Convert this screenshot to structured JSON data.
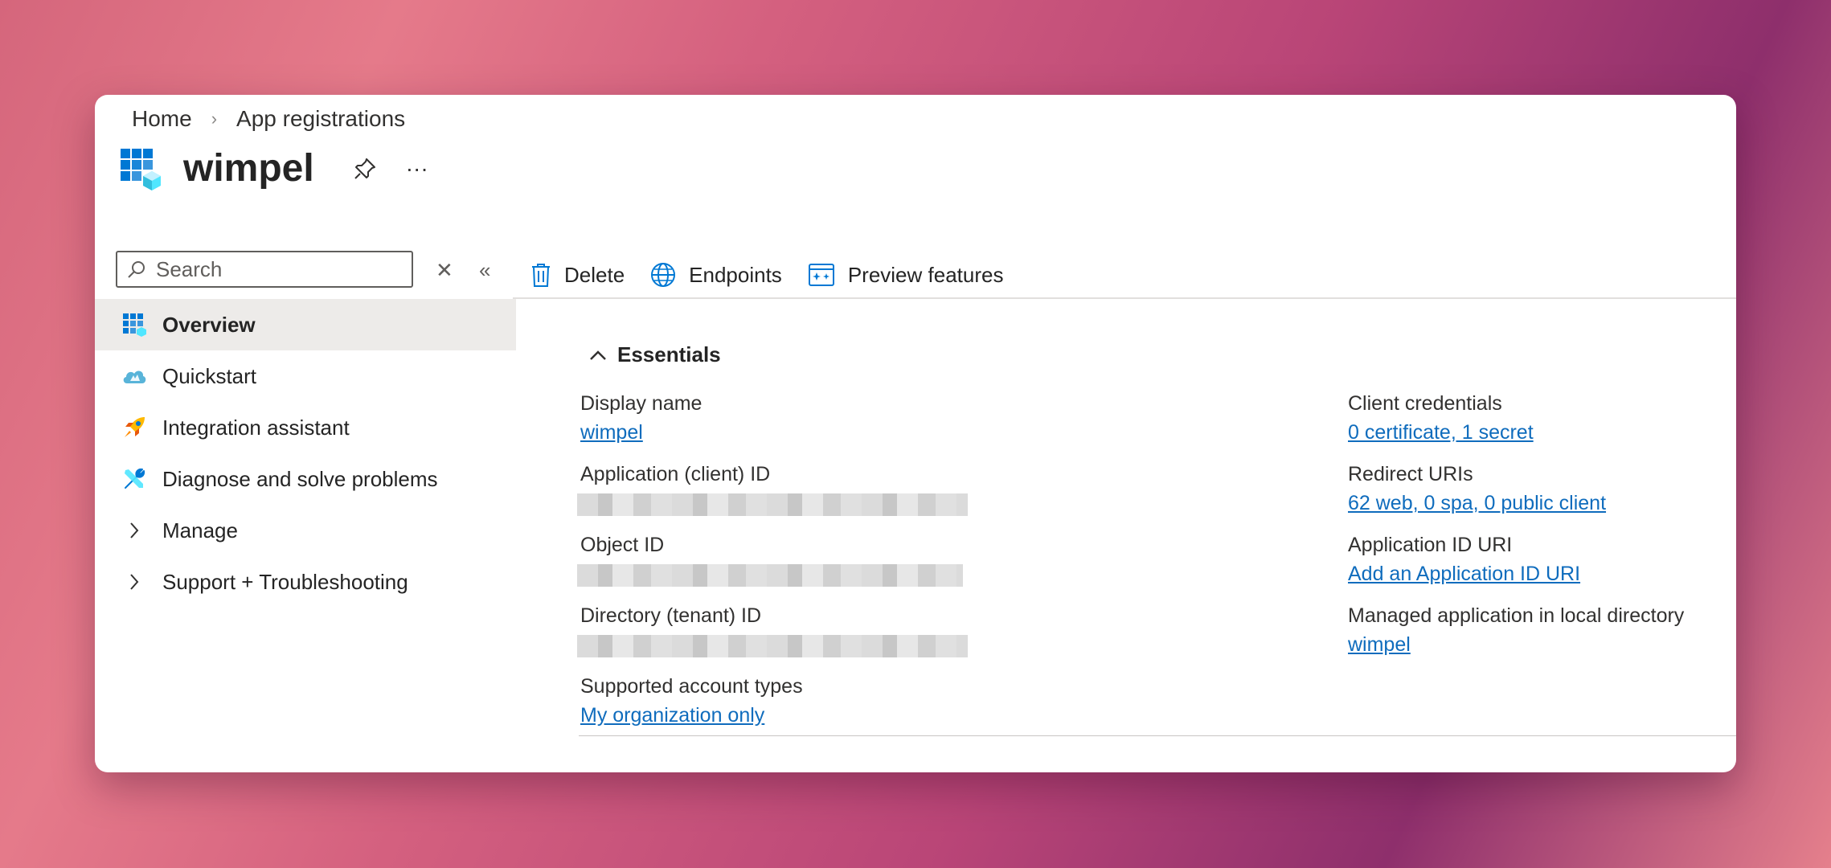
{
  "breadcrumb": {
    "home": "Home",
    "separator": "›",
    "current": "App registrations"
  },
  "app": {
    "title": "wimpel",
    "more_label": "···"
  },
  "search": {
    "placeholder": "Search"
  },
  "sidebar": {
    "clear_label": "✕",
    "collapse_label": "«",
    "items": [
      {
        "label": "Overview",
        "icon": "app-grid-icon",
        "active": true
      },
      {
        "label": "Quickstart",
        "icon": "cloud-icon"
      },
      {
        "label": "Integration assistant",
        "icon": "rocket-icon"
      },
      {
        "label": "Diagnose and solve problems",
        "icon": "wrench-icon"
      },
      {
        "label": "Manage",
        "icon": "chevron-right-icon"
      },
      {
        "label": "Support + Troubleshooting",
        "icon": "chevron-right-icon"
      }
    ]
  },
  "toolbar": {
    "delete": "Delete",
    "endpoints": "Endpoints",
    "preview": "Preview features"
  },
  "essentials": {
    "header": "Essentials",
    "left": {
      "display_name_label": "Display name",
      "display_name_value": "wimpel",
      "app_id_label": "Application (client) ID",
      "object_id_label": "Object ID",
      "tenant_id_label": "Directory (tenant) ID",
      "account_types_label": "Supported account types",
      "account_types_value": "My organization only"
    },
    "right": {
      "client_credentials_label": "Client credentials",
      "client_credentials_value": "0 certificate, 1 secret",
      "redirect_uris_label": "Redirect URIs",
      "redirect_uris_value": "62 web, 0 spa, 0 public client",
      "app_id_uri_label": "Application ID URI",
      "app_id_uri_value": "Add an Application ID URI",
      "managed_app_label": "Managed application in local directory",
      "managed_app_value": "wimpel"
    }
  },
  "colors": {
    "link": "#0f6cbd",
    "azure_blue": "#0078d4",
    "active_bg": "#edebe9"
  }
}
